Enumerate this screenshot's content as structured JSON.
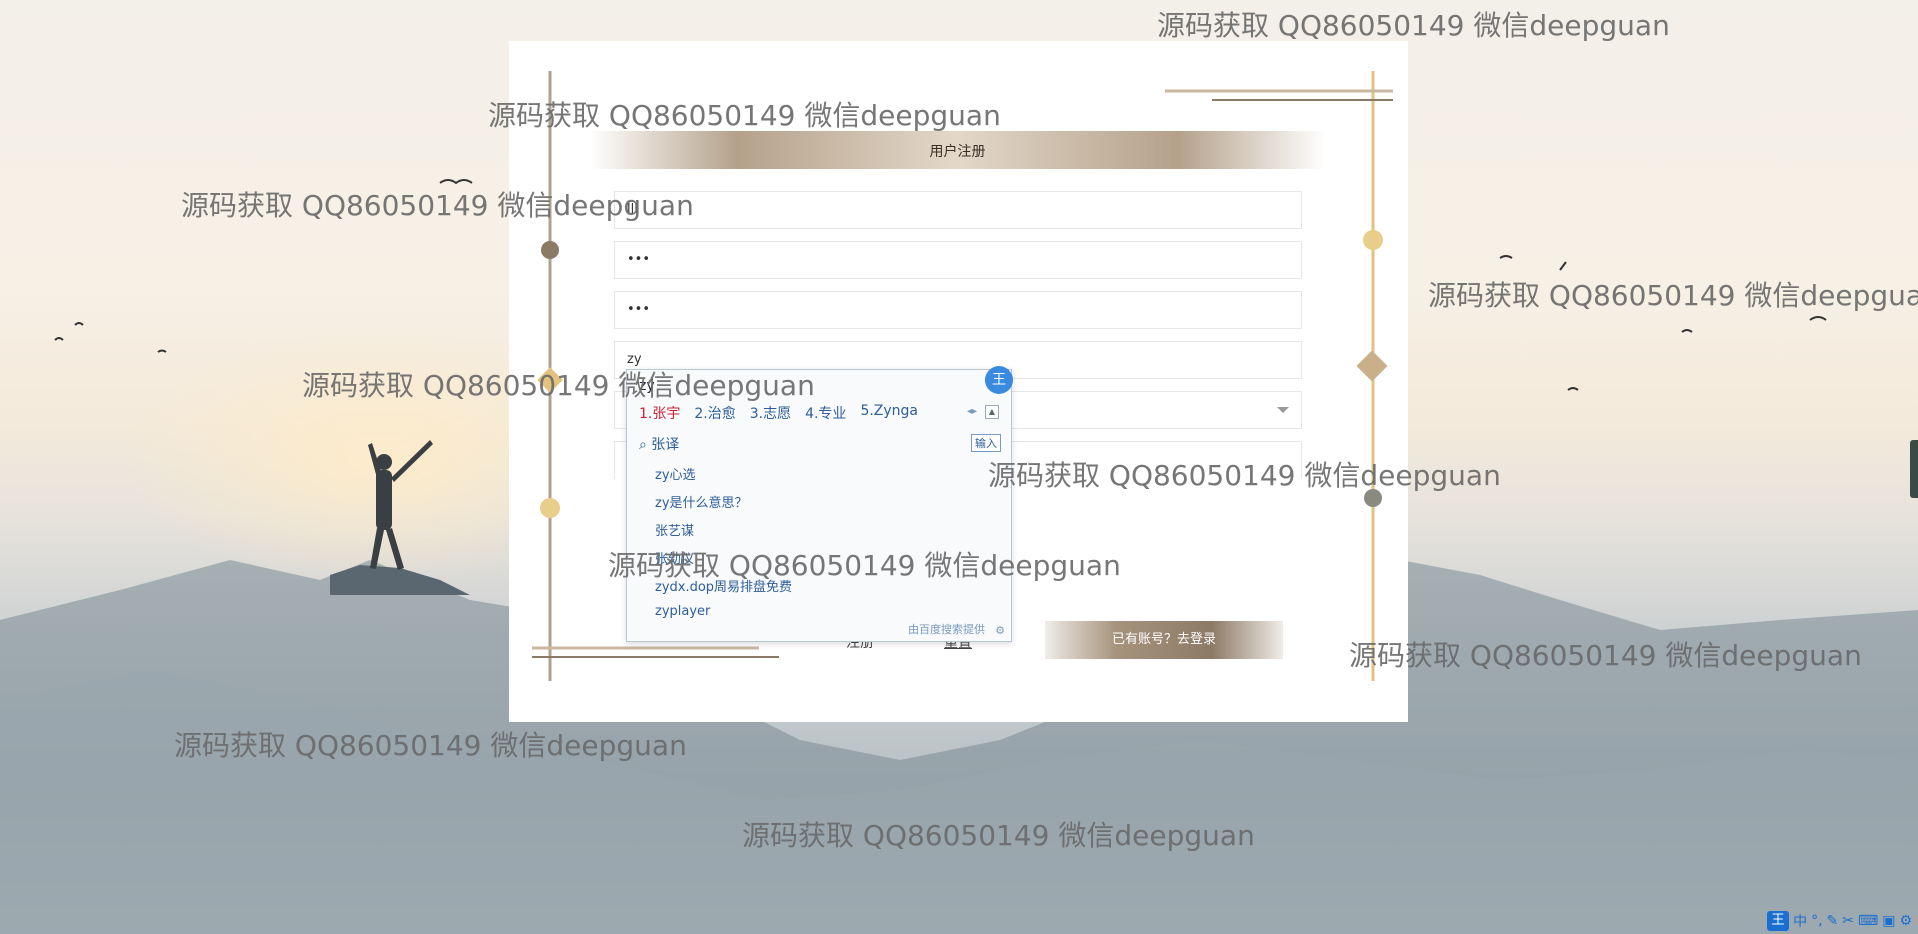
{
  "form": {
    "title": "用户注册",
    "fields": [
      {
        "name": "username",
        "value": "lll"
      },
      {
        "name": "password",
        "value": "•••"
      },
      {
        "name": "confirm_password",
        "value": "•••"
      },
      {
        "name": "text_input",
        "value": "zy"
      },
      {
        "name": "select",
        "value": ""
      }
    ],
    "register_label": "注册",
    "reset_label": "重置",
    "login_link_label": "已有账号？去登录"
  },
  "ime": {
    "pinyin": "zy",
    "candidates": [
      "1.张宇",
      "2.治愈",
      "3.志愿",
      "4.专业",
      "5.Zynga"
    ],
    "search_term": "张译",
    "input_button": "输入",
    "suggestions": [
      "zy心选",
      "zy是什么意思？",
      "张艺谋",
      "张幼仪",
      "zydx.dop周易排盘免费",
      "zyplayer"
    ],
    "footer": "由百度搜索提供",
    "badge": "王"
  },
  "watermark": "源码获取 QQ86050149 微信deepguan",
  "taskbar": {
    "ime_badge": "王",
    "lang": "中"
  },
  "colors": {
    "accent": "#a6937c",
    "gold": "#e3c27d",
    "ime_blue": "#3a8be0"
  }
}
